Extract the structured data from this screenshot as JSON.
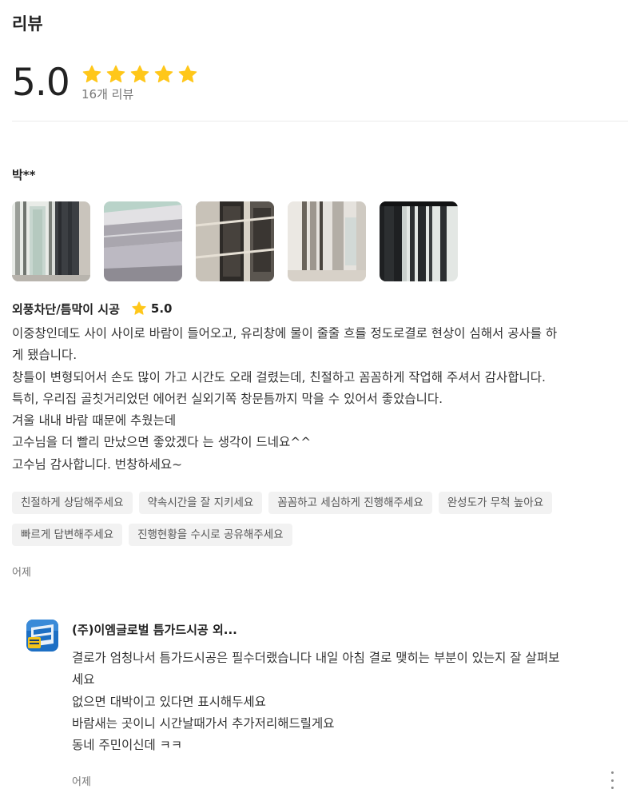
{
  "section": {
    "title": "리뷰"
  },
  "summary": {
    "score": "5.0",
    "stars_filled": 5,
    "stars_total": 5,
    "star_color": "#FFC71A",
    "count_label": "16개 리뷰"
  },
  "review": {
    "author": "박**",
    "photos": [
      {
        "alt": "photo-1"
      },
      {
        "alt": "photo-2"
      },
      {
        "alt": "photo-3"
      },
      {
        "alt": "photo-4"
      },
      {
        "alt": "photo-5"
      }
    ],
    "service_name": "외풍차단/틈막이 시공",
    "rating": "5.0",
    "body_lines": [
      "이중창인데도 사이 사이로 바람이 들어오고, 유리창에 물이 줄줄 흐를 정도로결로 현상이 심해서 공사를 하",
      "게 됐습니다.",
      "창틀이 변형되어서 손도 많이 가고 시간도 오래 걸렸는데, 친절하고 꼼꼼하게 작업해 주셔서 감사합니다.",
      "특히, 우리집 골칫거리었던 에어컨 실외기쪽 창문틈까지 막을 수 있어서 좋았습니다.",
      "겨울 내내 바람 때문에 추웠는데",
      "고수님을 더 빨리 만났으면 좋았겠다 는 생각이 드네요^^",
      "고수님 감사합니다.  번창하세요~"
    ],
    "tags": [
      "친절하게 상담해주세요",
      "약속시간을 잘 지키세요",
      "꼼꼼하고 세심하게 진행해주세요",
      "완성도가 무척 높아요",
      "빠르게 답변해주세요",
      "진행현황을 수시로 공유해주세요"
    ],
    "date": "어제"
  },
  "reply": {
    "name": "(주)이엠글로벌 틈가드시공 외...",
    "body_lines": [
      "결로가 엄청나서 틈가드시공은 필수더랬습니다 내일 아침 결로 맺히는 부분이 있는지 잘 살펴보",
      "세요",
      "없으면 대박이고  있다면 표시해두세요",
      "바람새는 곳이니 시간날때가서 추가저리해드릴게요",
      "동네 주민이신데 ㅋㅋ"
    ],
    "date": "어제",
    "more_icon": "more-vertical-icon"
  }
}
